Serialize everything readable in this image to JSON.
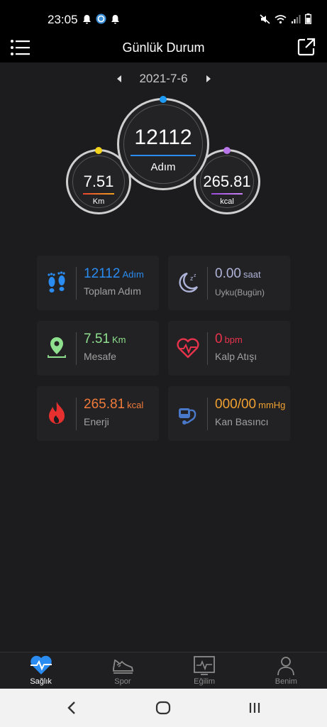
{
  "status_bar": {
    "time": "23:05"
  },
  "header": {
    "title": "Günlük Durum"
  },
  "date_nav": {
    "date": "2021-7-6"
  },
  "rings": {
    "steps": {
      "value": "12112",
      "unit": "Adım"
    },
    "distance": {
      "value": "7.51",
      "unit": "Km"
    },
    "calories": {
      "value": "265.81",
      "unit": "kcal"
    }
  },
  "cards": {
    "steps": {
      "value": "12112",
      "unit": "Adım",
      "label": "Toplam Adım",
      "color": "#2a8cf0"
    },
    "sleep": {
      "value": "0.00",
      "unit": "saat",
      "label": "Uyku(Bugün)",
      "color": "#aeb4d8"
    },
    "distance": {
      "value": "7.51",
      "unit": "Km",
      "label": "Mesafe",
      "color": "#8ee08e"
    },
    "heart": {
      "value": "0",
      "unit": "bpm",
      "label": "Kalp Atışı",
      "color": "#e8334c"
    },
    "energy": {
      "value": "265.81",
      "unit": "kcal",
      "label": "Enerji",
      "color": "#f07a3a"
    },
    "blood_pressure": {
      "value": "000/00",
      "unit": "mmHg",
      "label": "Kan Basıncı",
      "color": "#f0a030"
    }
  },
  "tabs": [
    {
      "label": "Sağlık",
      "icon": "heart-pulse-icon",
      "active": true
    },
    {
      "label": "Spor",
      "icon": "sneaker-icon",
      "active": false
    },
    {
      "label": "Eğilim",
      "icon": "trend-monitor-icon",
      "active": false
    },
    {
      "label": "Benim",
      "icon": "person-icon",
      "active": false
    }
  ],
  "colors": {
    "accent": "#2a8cf0",
    "background": "#1c1c1e"
  }
}
